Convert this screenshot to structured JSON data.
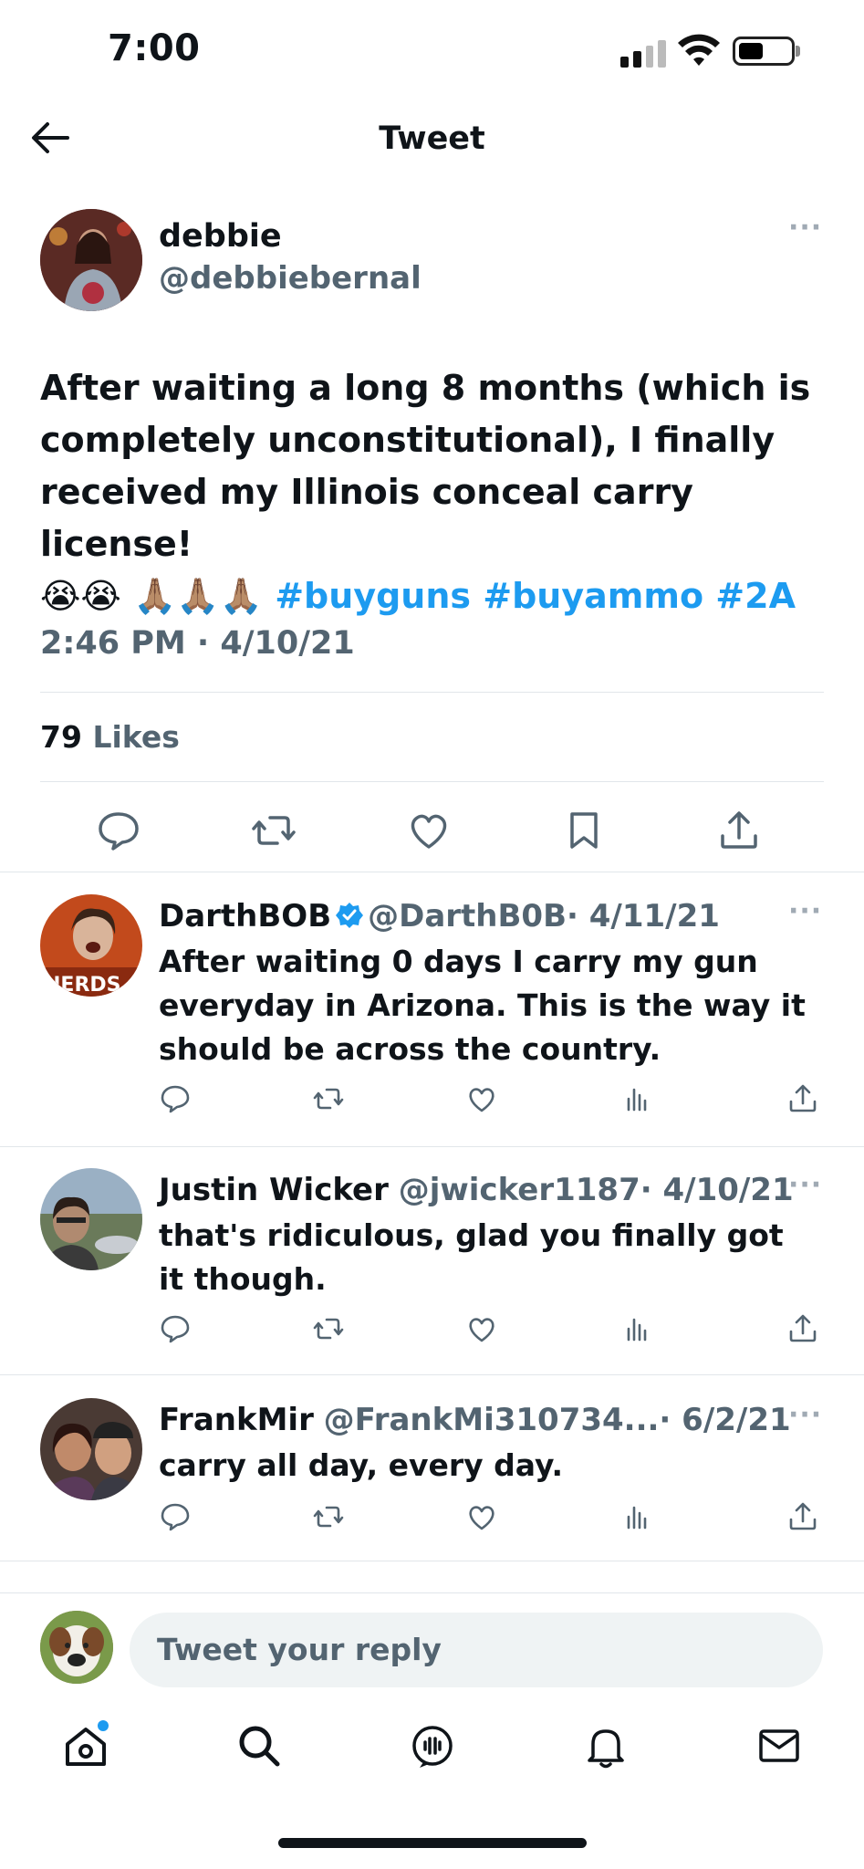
{
  "status": {
    "time": "7:00"
  },
  "header": {
    "title": "Tweet"
  },
  "tweet": {
    "name": "debbie",
    "handle": "@debbiebernal",
    "text_line1": "After waiting a long 8 months (which is",
    "text_line2": "completely unconstitutional), I finally",
    "text_line3": "received my Illinois conceal carry license!",
    "emojis": "😭😭 🙏🏽🙏🏽🙏🏽",
    "hashtags": [
      "#buyguns",
      "#buyammo",
      "#2A"
    ],
    "timestamp": "2:46 PM · 4/10/21",
    "likes_count": "79",
    "likes_label": "Likes"
  },
  "replies": [
    {
      "name": "DarthBOB",
      "handle": "@DarthB0B",
      "date": "· 4/11/21",
      "verified": true,
      "text": "After waiting 0 days I carry my gun everyday in Arizona. This is the way it should be across the country."
    },
    {
      "name": "Justin Wicker",
      "handle": "@jwicker1187",
      "date": "· 4/10/21",
      "verified": false,
      "text": "that's ridiculous, glad you finally got it though."
    },
    {
      "name": "FrankMir",
      "handle": "@FrankMi310734...",
      "date": "· 6/2/21",
      "verified": false,
      "text": "carry all day, every day."
    }
  ],
  "compose": {
    "placeholder": "Tweet your reply"
  },
  "colors": {
    "accent": "#1d9bf0",
    "secondary_text": "#536471",
    "divider": "#e1e6ea"
  },
  "icons": [
    "back-arrow-icon",
    "more-icon",
    "reply-icon",
    "retweet-icon",
    "like-icon",
    "bookmark-icon",
    "share-icon",
    "views-icon",
    "home-icon",
    "search-icon",
    "spaces-icon",
    "notifications-icon",
    "messages-icon"
  ]
}
